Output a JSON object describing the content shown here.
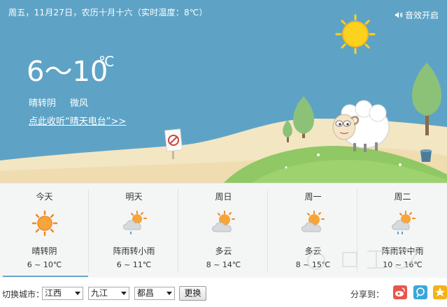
{
  "header": {
    "date_line": "周五，11月27日，农历十月十六（实时温度：8℃）",
    "sound_label": "音效开启"
  },
  "current": {
    "temp_range": "6～10",
    "temp_unit": "℃",
    "condition": "晴转阴",
    "wind": "微风",
    "radio_link": "点此收听“晴天电台”>>"
  },
  "forecast": [
    {
      "day": "今天",
      "icon": "sun-icon",
      "desc": "晴转阴",
      "temp": "6 ~ 10℃",
      "active": true
    },
    {
      "day": "明天",
      "icon": "sun-cloud-rain-icon",
      "desc": "阵雨转小雨",
      "temp": "6 ~ 11℃",
      "active": false
    },
    {
      "day": "周日",
      "icon": "partly-cloudy-icon",
      "desc": "多云",
      "temp": "8 ~ 14℃",
      "active": false
    },
    {
      "day": "周一",
      "icon": "partly-cloudy-icon",
      "desc": "多云",
      "temp": "8 ~ 15℃",
      "active": false
    },
    {
      "day": "周二",
      "icon": "sun-cloud-rain-icon",
      "desc": "阵雨转中雨",
      "temp": "10 ~ 16℃",
      "active": false
    }
  ],
  "bottom": {
    "city_label": "切换城市：",
    "province": "江西",
    "city": "九江",
    "district": "都昌",
    "change_button": "更换",
    "share_label": "分享到："
  },
  "share_icons": [
    {
      "name": "weibo-share-icon",
      "color": "#e8574b"
    },
    {
      "name": "tencent-share-icon",
      "color": "#3aa8d8"
    },
    {
      "name": "qzone-share-icon",
      "color": "#f2b21a"
    }
  ],
  "colors": {
    "sky": "#5ea3c6",
    "sun": "#fcd21e",
    "sand": "#f3e6c3",
    "grass": "#8fc864",
    "tree": "#8cc277",
    "forecast_bg": "#f4f5f5",
    "active_bar": "#6aa7cf"
  }
}
